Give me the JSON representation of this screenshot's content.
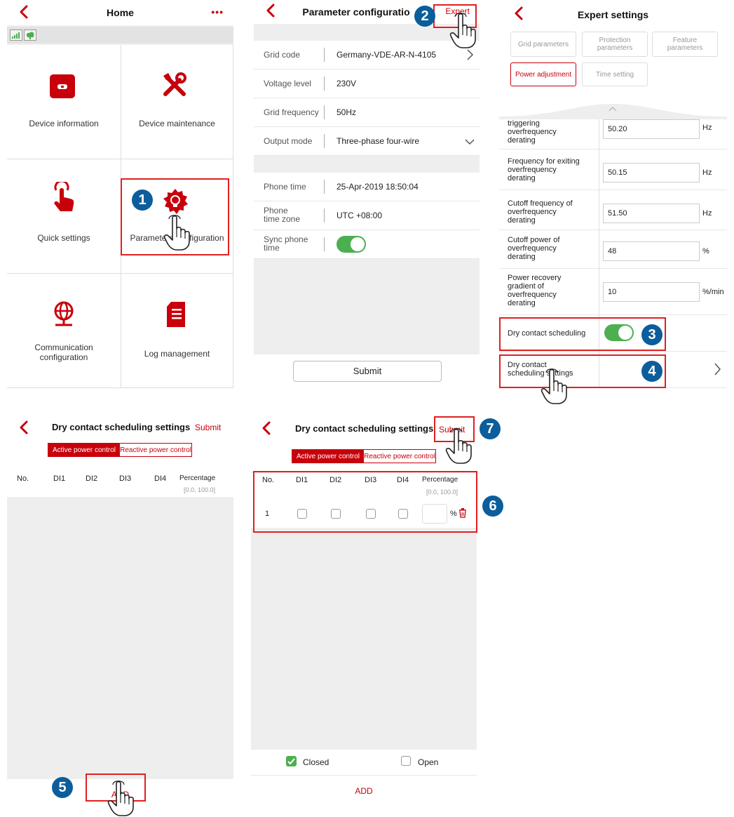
{
  "panel1": {
    "title": "Home",
    "more": "•••",
    "tiles": [
      {
        "label": "Device information"
      },
      {
        "label": "Device maintenance"
      },
      {
        "label": "Quick settings"
      },
      {
        "label": "Parameters configuration"
      },
      {
        "label": "Communication\nconfiguration"
      },
      {
        "label": "Log management"
      }
    ]
  },
  "panel2": {
    "title": "Parameter configuratio",
    "expert": "Expert",
    "rows": [
      {
        "key": "Grid code",
        "value": "Germany-VDE-AR-N-4105"
      },
      {
        "key": "Voltage level",
        "value": "230V"
      },
      {
        "key": "Grid frequency",
        "value": "50Hz"
      },
      {
        "key": "Output mode",
        "value": "Three-phase four-wire"
      }
    ],
    "rows2": [
      {
        "key": "Phone time",
        "value": "25-Apr-2019 18:50:04"
      },
      {
        "key": "Phone\ntime zone",
        "value": "UTC +08:00"
      },
      {
        "key": "Sync phone\ntime",
        "value": ""
      }
    ],
    "submit": "Submit"
  },
  "panel3": {
    "title": "Expert settings",
    "tabs": [
      "Grid parameters",
      "Protection\nparameters",
      "Feature\nparameters",
      "Power adjustment",
      "Time setting"
    ],
    "rows": [
      {
        "key": "triggering\noverfrequency\nderating",
        "value": "50.20",
        "unit": "Hz"
      },
      {
        "key": "Frequency for exiting\noverfrequency\nderating",
        "value": "50.15",
        "unit": "Hz"
      },
      {
        "key": "Cutoff frequency of\noverfrequency\nderating",
        "value": "51.50",
        "unit": "Hz"
      },
      {
        "key": "Cutoff power of\noverfrequency\nderating",
        "value": "48",
        "unit": "%"
      },
      {
        "key": "Power recovery\ngradient of\noverfrequency\nderating",
        "value": "10",
        "unit": "%/min"
      }
    ],
    "dry_contact": "Dry contact scheduling",
    "dry_contact_settings": "Dry contact\nscheduling settings"
  },
  "panel4": {
    "title": "Dry contact scheduling settings",
    "submit": "Submit",
    "seg_active": "Active power control",
    "seg_reactive": "Reactive power control",
    "cols": [
      "No.",
      "DI1",
      "DI2",
      "DI3",
      "DI4",
      "Percentage"
    ],
    "range": "[0.0, 100.0]",
    "add": "ADD"
  },
  "panel5": {
    "title": "Dry contact scheduling settings",
    "submit": "Submit",
    "seg_active": "Active power control",
    "seg_reactive": "Reactive power control",
    "cols": [
      "No.",
      "DI1",
      "DI2",
      "DI3",
      "DI4",
      "Percentage"
    ],
    "range": "[0.0, 100.0]",
    "row_no": "1",
    "pct": "%",
    "closed": "Closed",
    "open": "Open",
    "add": "ADD"
  },
  "badges": [
    "1",
    "2",
    "3",
    "4",
    "5",
    "6",
    "7"
  ],
  "colors": {
    "accent": "#c7000b",
    "badge": "#0c5d9b",
    "toggle": "#4caf50",
    "highlight": "#e02020"
  }
}
